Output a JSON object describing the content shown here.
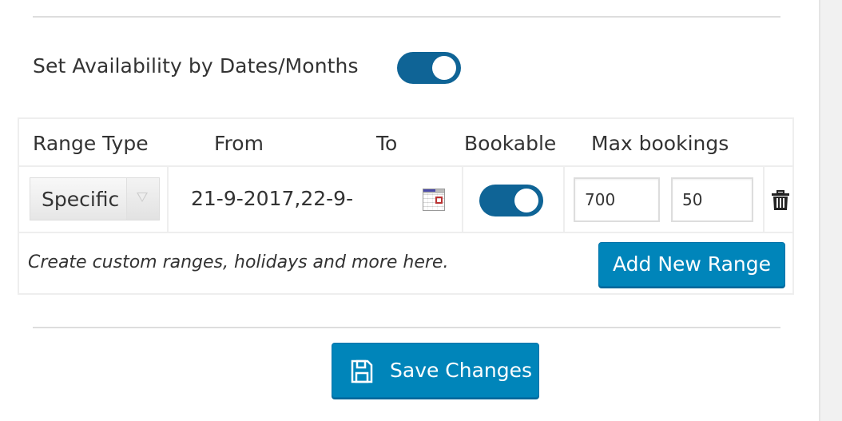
{
  "section": {
    "title": "Set Availability by Dates/Months",
    "enabled": true
  },
  "table": {
    "headers": {
      "range_type": "Range Type",
      "from": "From",
      "to": "To",
      "bookable": "Bookable",
      "max_bookings": "Max bookings"
    },
    "rows": [
      {
        "range_type": "Specific",
        "dates": "21-9-2017,22-9-",
        "bookable": true,
        "max_bookings_1": "700",
        "max_bookings_2": "50"
      }
    ],
    "hint": "Create custom ranges, holidays and more here.",
    "add_button": "Add New Range"
  },
  "footer": {
    "save_button": "Save Changes"
  },
  "colors": {
    "toggle_on": "#0f6496",
    "button_primary": "#0085ba"
  }
}
